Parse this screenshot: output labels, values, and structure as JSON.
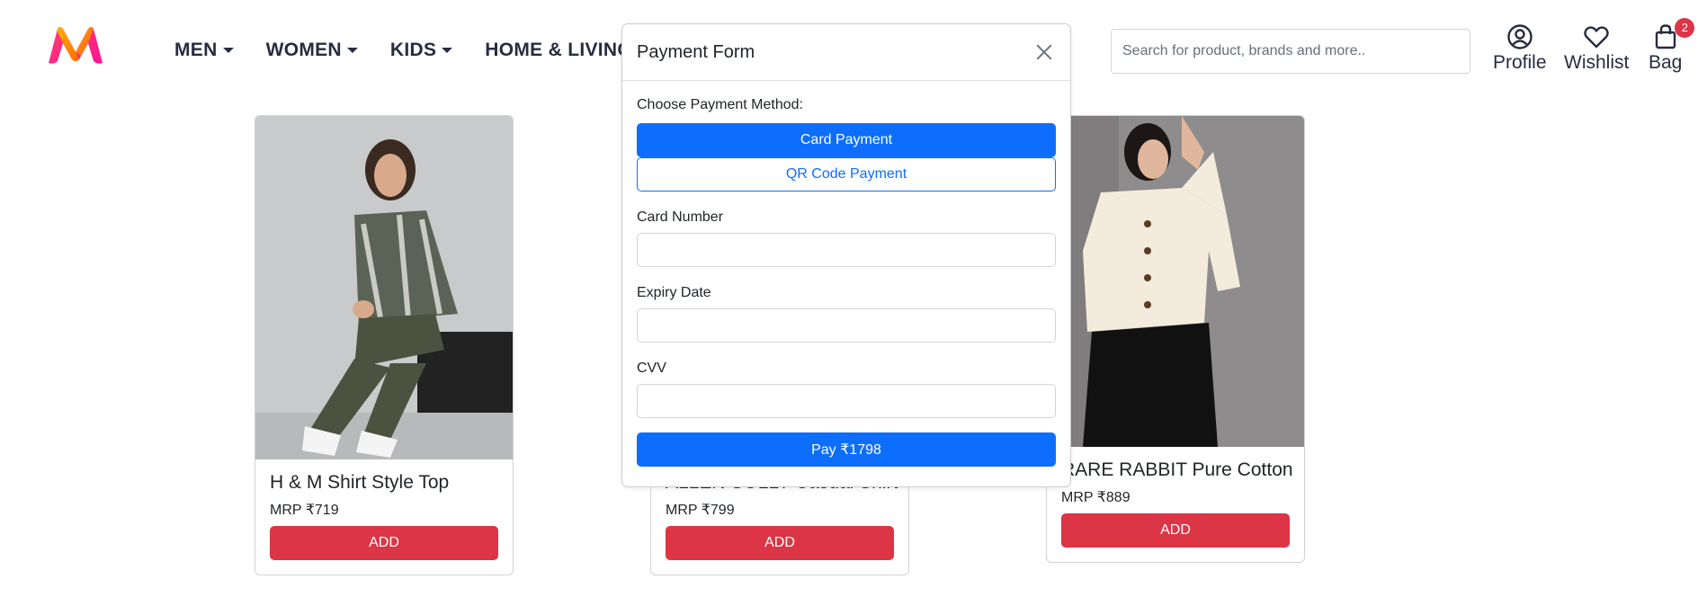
{
  "brand": {
    "logo_icon": "myntra-logo-icon"
  },
  "nav": {
    "items": [
      {
        "label": "MEN"
      },
      {
        "label": "WOMEN"
      },
      {
        "label": "KIDS"
      },
      {
        "label": "HOME & LIVING"
      }
    ]
  },
  "search": {
    "placeholder": "Search for product, brands and more..",
    "value": ""
  },
  "header_icons": {
    "profile": {
      "label": "Profile",
      "icon": "user-circle-icon"
    },
    "wishlist": {
      "label": "Wishlist",
      "icon": "heart-icon"
    },
    "bag": {
      "label": "Bag",
      "icon": "shopping-bag-icon",
      "count": "2"
    }
  },
  "products": [
    {
      "name": "H & M Shirt Style Top",
      "price": "MRP ₹719",
      "add_label": "ADD"
    },
    {
      "name": "ALLEN SOLLY Casual Shirt",
      "price": "MRP ₹799",
      "add_label": "ADD"
    },
    {
      "name": "RARE RABBIT Pure Cotton",
      "price": "MRP ₹889",
      "add_label": "ADD"
    }
  ],
  "payment_modal": {
    "title": "Payment Form",
    "choose_label": "Choose Payment Method:",
    "card_payment_label": "Card Payment",
    "qr_payment_label": "QR Code Payment",
    "card_number_label": "Card Number",
    "card_number_value": "",
    "expiry_label": "Expiry Date",
    "expiry_value": "",
    "cvv_label": "CVV",
    "cvv_value": "",
    "pay_label": "Pay ₹1798"
  },
  "colors": {
    "primary": "#0d6efd",
    "danger": "#dc3545",
    "text": "#282c3f"
  }
}
